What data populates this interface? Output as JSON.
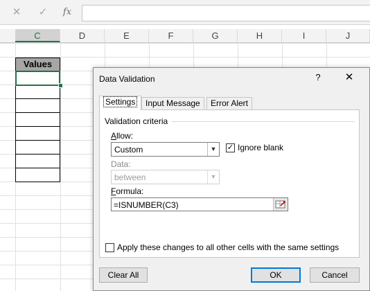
{
  "formula_bar": {
    "cancel_icon": "✕",
    "enter_icon": "✓",
    "fx_label": "fx",
    "value": ""
  },
  "grid": {
    "columns": [
      "C",
      "D",
      "E",
      "F",
      "G",
      "H",
      "I",
      "J"
    ],
    "selected_column": "C",
    "values_header": "Values"
  },
  "dialog": {
    "title": "Data Validation",
    "help": "?",
    "close": "✕",
    "tabs": [
      "Settings",
      "Input Message",
      "Error Alert"
    ],
    "active_tab": "Settings",
    "criteria_label": "Validation criteria",
    "allow_label": "Allow:",
    "allow_value": "Custom",
    "ignore_blank_label": "Ignore blank",
    "ignore_blank_checked": true,
    "data_label": "Data:",
    "data_value": "between",
    "formula_label": "Formula:",
    "formula_value": "=ISNUMBER(C3)",
    "apply_label": "Apply these changes to all other cells with the same settings",
    "apply_checked": false,
    "buttons": {
      "clear_all": "Clear All",
      "ok": "OK",
      "cancel": "Cancel"
    }
  },
  "colors": {
    "excel_green": "#217346",
    "focus_blue": "#0078d7"
  }
}
